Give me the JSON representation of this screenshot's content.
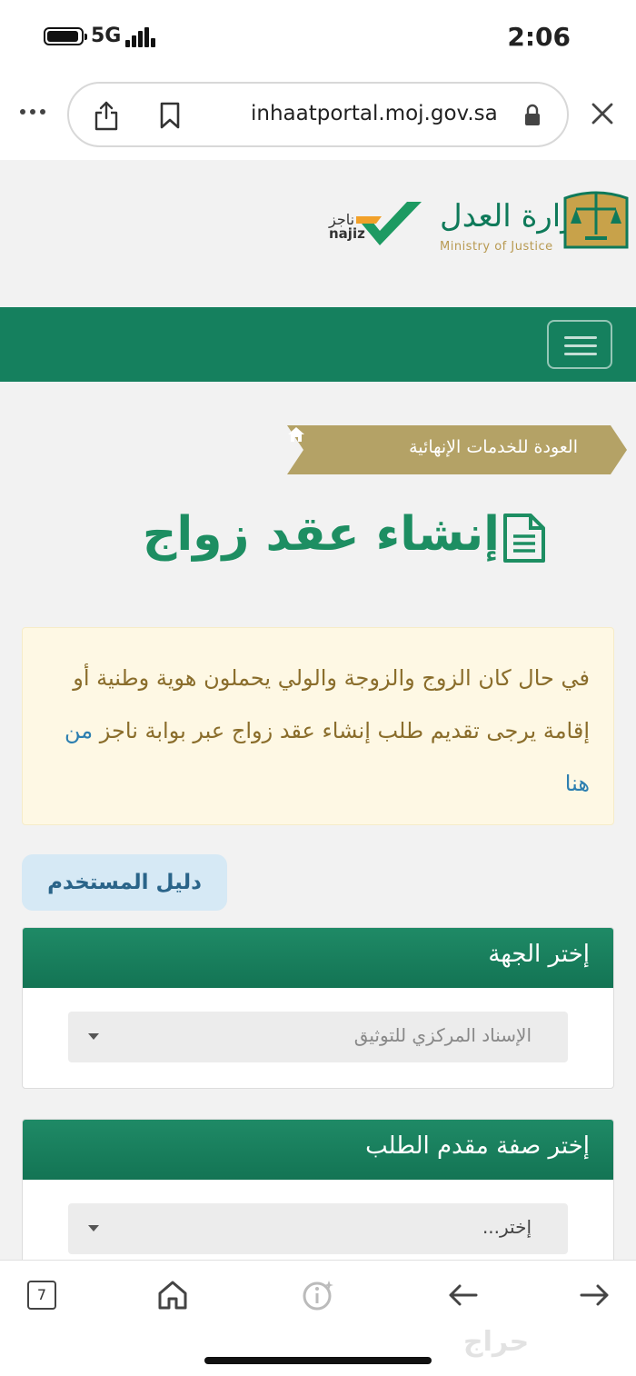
{
  "status_bar": {
    "network": "5G",
    "time": "2:06"
  },
  "browser": {
    "url": "inhaatportal.moj.gov.sa"
  },
  "header": {
    "najiz_ar": "ناجز",
    "najiz_en": "najiz",
    "ministry_ar": "وزارة العدل",
    "ministry_en": "Ministry of Justice"
  },
  "breadcrumb": {
    "back_label": "العودة للخدمات الإنهائية"
  },
  "page": {
    "title": "إنشاء عقد زواج"
  },
  "alert": {
    "text": "في حال كان الزوج والزوجة والولي يحملون هوية وطنية أو إقامة يرجى تقديم طلب إنشاء عقد زواج عبر بوابة ناجز",
    "link_label": "من هنا"
  },
  "guide": {
    "label": "دليل المستخدم"
  },
  "panels": [
    {
      "title": "إختر الجهة",
      "selected": "الإسناد المركزي للتوثيق"
    },
    {
      "title": "إختر صفة مقدم الطلب",
      "selected": "إختر..."
    }
  ],
  "toolbar": {
    "tab_count": "7"
  },
  "watermark": {
    "text": "حراج"
  },
  "colors": {
    "primary_green": "#15805e",
    "title_green": "#1d8e62",
    "gold": "#b4a266",
    "alert_bg": "#fef8e4",
    "alert_text": "#8a6d2b",
    "link": "#2d7fb0"
  }
}
